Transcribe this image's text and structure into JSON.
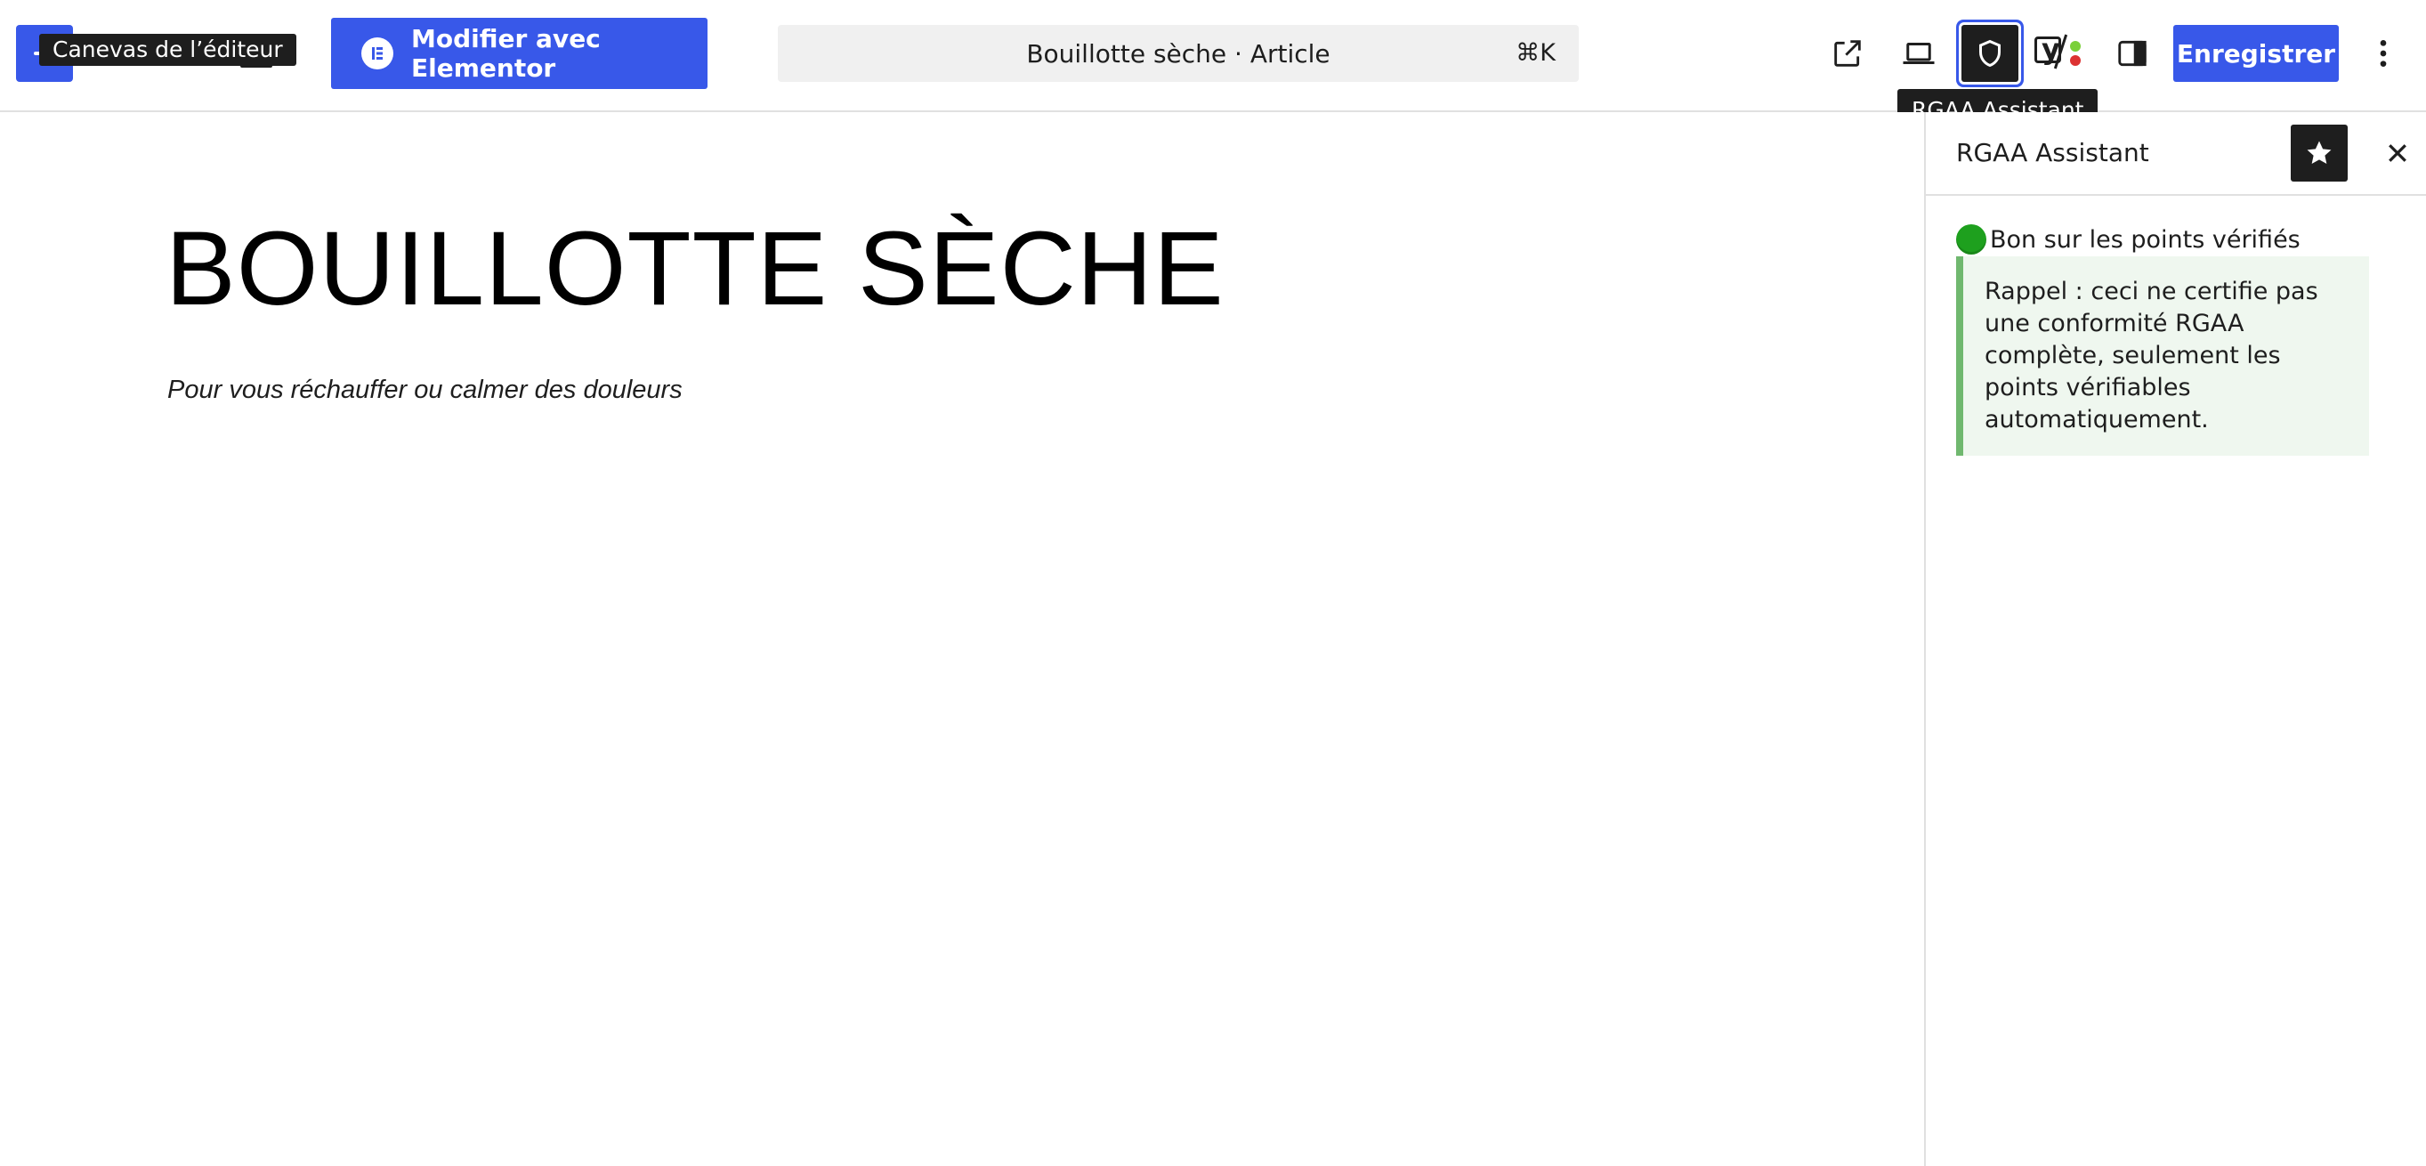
{
  "toolbar": {
    "canvas_tooltip": "Canevas de l’éditeur",
    "elementor_label": "Modifier avec Elementor",
    "command_title": "Bouillotte sèche · Article",
    "command_shortcut": "⌘K",
    "rgaa_tooltip": "RGAA Assistant",
    "save_label": "Enregistrer",
    "yoast_letter": "y",
    "icons": {
      "toggle": "minus-icon",
      "document_overview": "list-view-icon",
      "elementor": "elementor-logo-icon",
      "view_post": "external-link-icon",
      "preview": "laptop-icon",
      "rgaa": "shield-icon",
      "yoast": "yoast-icon",
      "settings": "sidebar-panel-icon",
      "more": "more-vertical-icon"
    },
    "colors": {
      "accent": "#3858e9",
      "dark": "#1e1e1e",
      "yoast_green": "#7ad03a",
      "yoast_red": "#dc3232"
    }
  },
  "post": {
    "title": "BOUILLOTTE SÈCHE",
    "subtitle": "Pour vous réchauffer ou calmer des douleurs"
  },
  "sidebar": {
    "title": "RGAA Assistant",
    "status": "Bon sur les points vérifiés",
    "status_color": "#1ea01e",
    "notice": "Rappel : ceci ne certifie pas une conformité RGAA complète, seulement les points vérifiables automatiquement.",
    "notice_colors": {
      "background": "#eff7ef",
      "border": "#70b86f"
    },
    "icons": {
      "pin": "star-icon",
      "close": "close-icon"
    }
  }
}
